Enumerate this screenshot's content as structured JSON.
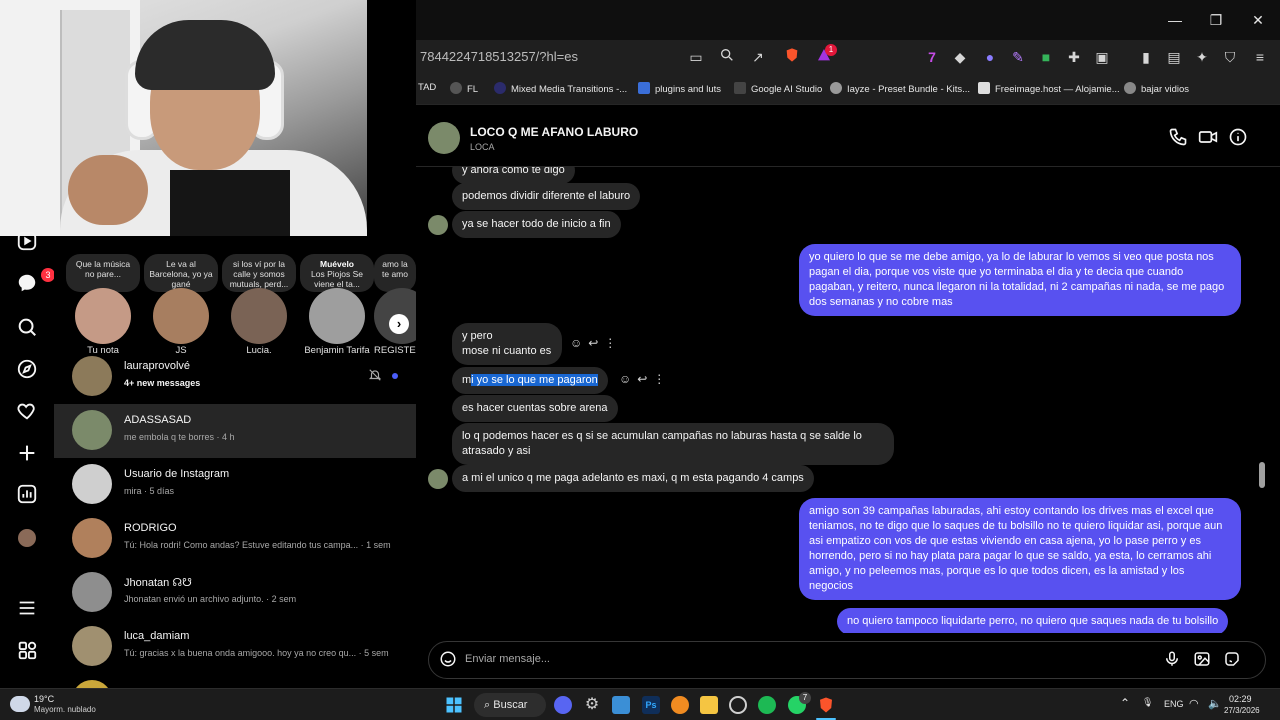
{
  "browser": {
    "url": "7844224718513257/?hl=es",
    "extensions_badge": "1",
    "bookmarks": [
      {
        "label": "TAD"
      },
      {
        "label": "FL"
      },
      {
        "label": "Mixed Media Transitions -..."
      },
      {
        "label": "plugins and luts"
      },
      {
        "label": "Google AI Studio"
      },
      {
        "label": "Iayze - Preset Bundle - Kits..."
      },
      {
        "label": "Freeimage.host — Alojamie..."
      },
      {
        "label": "bajar vidios"
      }
    ]
  },
  "leftnav": {
    "notifications_badge": "3"
  },
  "notes": [
    {
      "text": "Que la música no pare...",
      "name": "Tu nota"
    },
    {
      "text": "Le va al Barcelona, yo ya gané",
      "name": "JS"
    },
    {
      "text": "si los ví por la calle y somos mutuals, perd...",
      "name": "Lucia."
    },
    {
      "title": "Muévelo",
      "text": "Los Piojos Se viene el ta...",
      "name": "Benjamin Tarifa"
    },
    {
      "text": "amo la te amo",
      "name": "REGISTE..."
    }
  ],
  "conversations": [
    {
      "name": "lauraprovolvé",
      "sub": "4+ new messages"
    },
    {
      "name": "ADASSASAD",
      "sub": "me embola q te borres · 4 h"
    },
    {
      "name": "Usuario de Instagram",
      "sub": "mira · 5 días"
    },
    {
      "name": "RODRIGO",
      "sub": "Tú: Hola rodri! Como andas? Estuve editando tus campa... · 1 sem"
    },
    {
      "name": "Jhonatan ☊☋",
      "sub": "Jhonatan envió un archivo adjunto. · 2 sem"
    },
    {
      "name": "luca_damiam",
      "sub": "Tú: gracias x la buena onda amigooo. hoy ya no creo qu... · 5 sem"
    }
  ],
  "chat": {
    "title": "LOCO Q ME AFANO LABURO",
    "handle": "LOCA",
    "messages": [
      {
        "dir": "in",
        "text": "y ahora como te digo"
      },
      {
        "dir": "in",
        "text": "podemos dividir diferente el laburo"
      },
      {
        "dir": "in",
        "text": "ya se hacer todo de inicio a fin"
      },
      {
        "dir": "out",
        "text": "yo quiero lo que se me debe amigo, ya lo de laburar lo vemos si veo que posta nos pagan el dia, porque vos viste que yo terminaba el dia y te decia que cuando pagaban, y reitero, nunca llegaron ni la totalidad, ni 2 campañas ni nada, se me pago dos semanas y no cobre mas"
      },
      {
        "dir": "in",
        "text": "y pero"
      },
      {
        "dir": "in",
        "text": "mose ni cuanto es"
      },
      {
        "dir": "in",
        "text_plain": "m",
        "text_selected": "i yo se lo que me pagaron"
      },
      {
        "dir": "in",
        "text": "es hacer cuentas sobre arena"
      },
      {
        "dir": "in",
        "text": "lo q podemos hacer es q si se acumulan campañas no laburas hasta q se salde lo atrasado y asi"
      },
      {
        "dir": "in",
        "text": "a mi el unico q me paga adelanto es maxi, q m esta pagando 4 camps"
      },
      {
        "dir": "out",
        "text": "amigo son 39 campañas laburadas, ahi estoy contando los drives mas el excel que teniamos, no te digo que lo saques de tu bolsillo no te quiero liquidar asi, porque aun asi empatizo con vos de que estas viviendo en casa ajena, yo lo pase perro y es horrendo, pero si no hay plata para pagar lo que se saldo, ya esta, lo cerramos ahi amigo, y no peleemos mas, porque es lo que todos dicen, es la amistad y los negocios"
      },
      {
        "dir": "out",
        "text": "no quiero tampoco liquidarte perro, no quiero que saques nada de tu bolsillo"
      }
    ],
    "composer_placeholder": "Enviar mensaje..."
  },
  "taskbar": {
    "weather_temp": "19°C",
    "weather_desc": "Mayorm. nublado",
    "search_label": "Buscar",
    "whatsapp_badge": "7",
    "lang": "ENG",
    "time": "02:29",
    "date": "27/3/2026"
  }
}
